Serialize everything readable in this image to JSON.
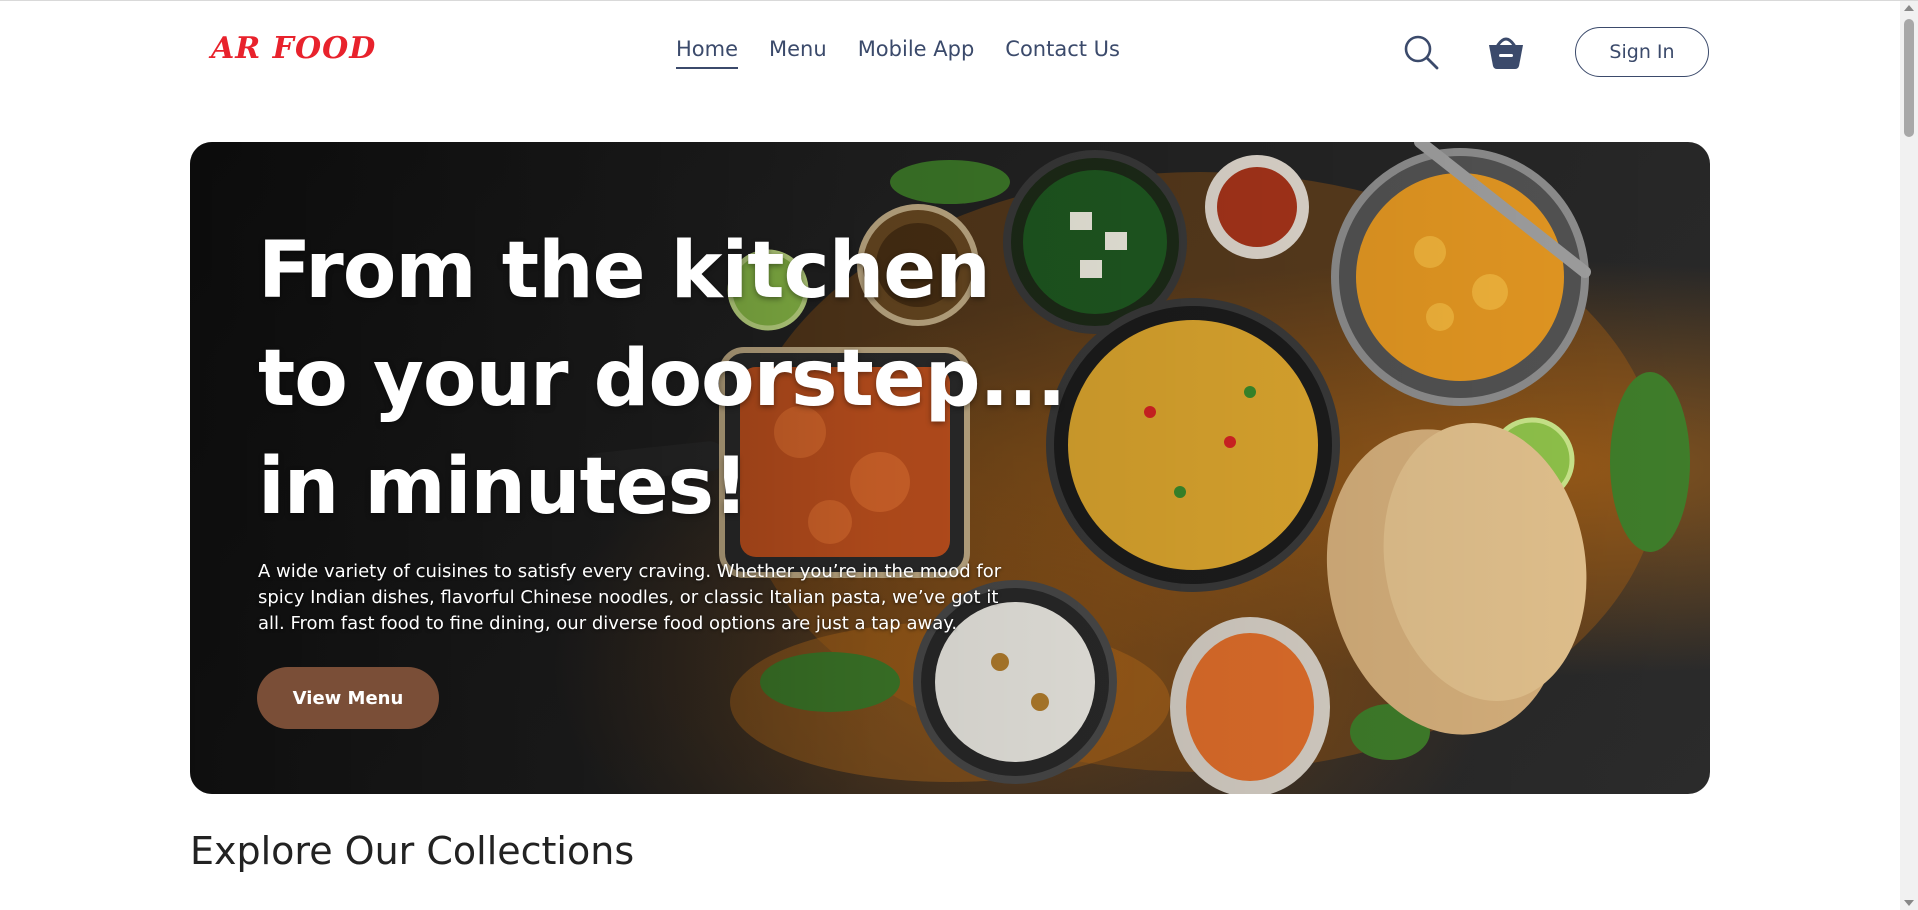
{
  "brand": {
    "logo_text": "AR FOOD",
    "logo_color": "#e8222c"
  },
  "nav": {
    "items": [
      {
        "label": "Home",
        "active": true
      },
      {
        "label": "Menu",
        "active": false
      },
      {
        "label": "Mobile App",
        "active": false
      },
      {
        "label": "Contact Us",
        "active": false
      }
    ],
    "icons": [
      "search-icon",
      "basket-icon"
    ],
    "signin_label": "Sign In"
  },
  "hero": {
    "title_lines": [
      "From the kitchen",
      "to your doorstep...",
      "in minutes!"
    ],
    "description": "A wide variety of cuisines to satisfy every craving. Whether you’re in the mood for spicy Indian dishes, flavorful Chinese noodles, or classic Italian pasta, we’ve got it all. From fast food to fine dining, our diverse food options are just a tap away.",
    "cta_label": "View Menu",
    "cta_color": "#7a4e37"
  },
  "collections": {
    "title": "Explore Our Collections"
  },
  "colors": {
    "nav_text": "#3b4a6b",
    "accent_red": "#e8222c"
  }
}
